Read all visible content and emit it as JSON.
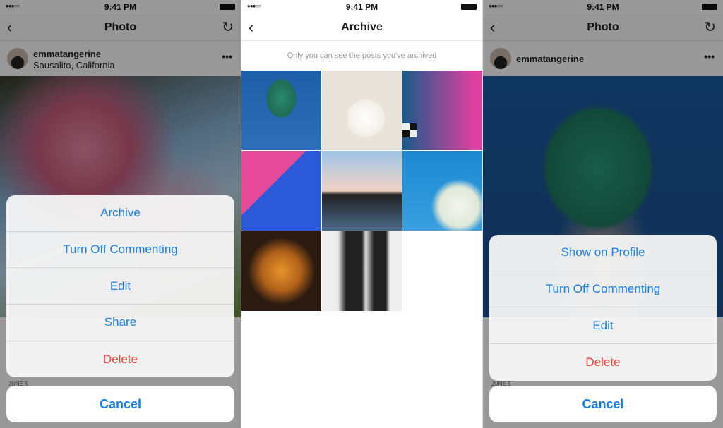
{
  "status": {
    "time": "9:41 PM",
    "signal": "●●●○○"
  },
  "left": {
    "title": "Photo",
    "username": "emmatangerine",
    "location": "Sausalito, California",
    "date": "JUNE 5",
    "actions": [
      {
        "label": "Archive"
      },
      {
        "label": "Turn Off Commenting"
      },
      {
        "label": "Edit"
      },
      {
        "label": "Share"
      },
      {
        "label": "Delete",
        "destructive": true
      }
    ],
    "cancel": "Cancel"
  },
  "middle": {
    "title": "Archive",
    "subtitle": "Only you can see the posts you've archived",
    "thumbnail_count": 8
  },
  "right": {
    "title": "Photo",
    "username": "emmatangerine",
    "date": "JUNE 5",
    "actions": [
      {
        "label": "Show on Profile"
      },
      {
        "label": "Turn Off Commenting"
      },
      {
        "label": "Edit"
      },
      {
        "label": "Delete",
        "destructive": true
      }
    ],
    "cancel": "Cancel"
  },
  "colors": {
    "accent": "#1a7ee6",
    "destructive": "#f0413a"
  }
}
